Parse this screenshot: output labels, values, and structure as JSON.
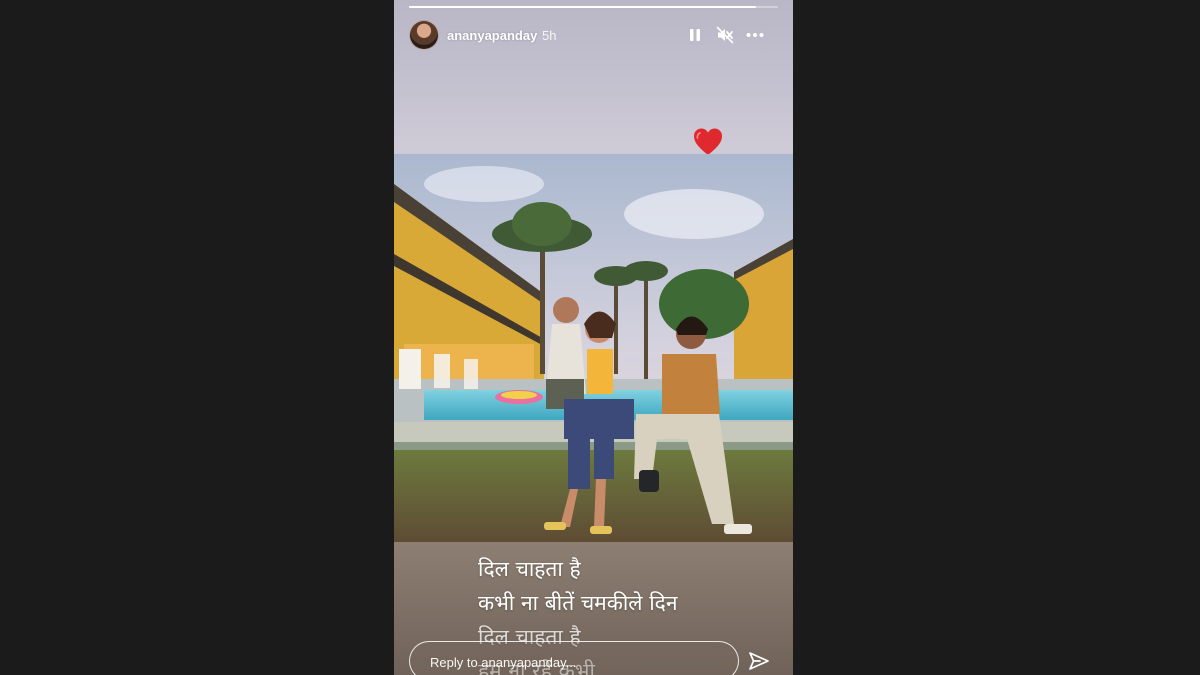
{
  "story": {
    "progress_fraction": 0.94,
    "username": "ananyapanday",
    "time_ago": "5h",
    "icons": {
      "pause": "pause-icon",
      "mute": "muted-speaker-icon",
      "more": "more-options-icon",
      "heart": "red-heart-emoji",
      "send": "paper-plane-icon"
    },
    "lyrics": [
      "दिल चाहता है",
      "कभी ना बीतें चमकीले दिन",
      "दिल चाहता है",
      "हम ना रहें कभी"
    ],
    "reply_placeholder": "Reply to ananyapanday..."
  },
  "colors": {
    "page_background": "#1b1b1b",
    "heart": "#e0292f"
  }
}
